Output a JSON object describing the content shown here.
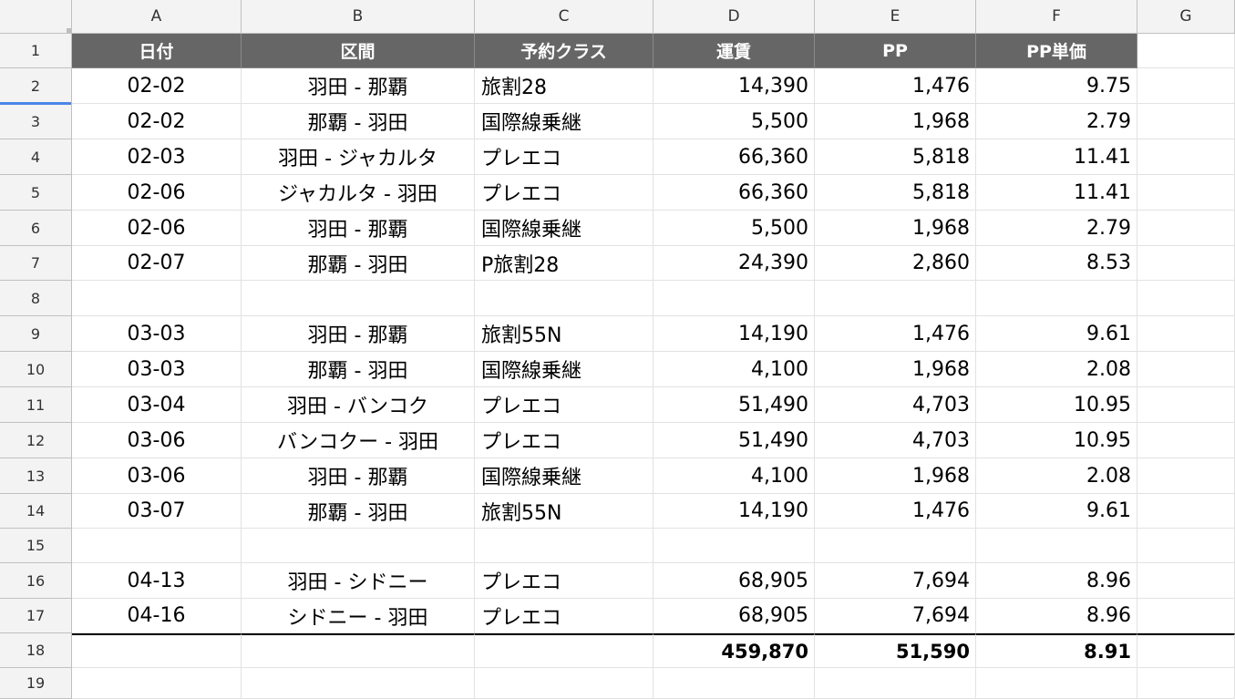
{
  "columns": [
    "A",
    "B",
    "C",
    "D",
    "E",
    "F",
    "G"
  ],
  "header": [
    "日付",
    "区間",
    "予約クラス",
    "運賃",
    "PP",
    "PP単価"
  ],
  "rows": [
    {
      "num": "1"
    },
    {
      "num": "2",
      "cells": [
        "02-02",
        "羽田 - 那覇",
        "旅割28",
        "14,390",
        "1,476",
        "9.75"
      ]
    },
    {
      "num": "3",
      "cells": [
        "02-02",
        "那覇 - 羽田",
        "国際線乗継",
        "5,500",
        "1,968",
        "2.79"
      ]
    },
    {
      "num": "4",
      "cells": [
        "02-03",
        "羽田 - ジャカルタ",
        "プレエコ",
        "66,360",
        "5,818",
        "11.41"
      ]
    },
    {
      "num": "5",
      "cells": [
        "02-06",
        "ジャカルタ - 羽田",
        "プレエコ",
        "66,360",
        "5,818",
        "11.41"
      ]
    },
    {
      "num": "6",
      "cells": [
        "02-06",
        "羽田 - 那覇",
        "国際線乗継",
        "5,500",
        "1,968",
        "2.79"
      ]
    },
    {
      "num": "7",
      "cells": [
        "02-07",
        "那覇 - 羽田",
        "P旅割28",
        "24,390",
        "2,860",
        "8.53"
      ]
    },
    {
      "num": "8",
      "cells": [
        "",
        "",
        "",
        "",
        "",
        ""
      ]
    },
    {
      "num": "9",
      "cells": [
        "03-03",
        "羽田 - 那覇",
        "旅割55N",
        "14,190",
        "1,476",
        "9.61"
      ]
    },
    {
      "num": "10",
      "cells": [
        "03-03",
        "那覇 - 羽田",
        "国際線乗継",
        "4,100",
        "1,968",
        "2.08"
      ]
    },
    {
      "num": "11",
      "cells": [
        "03-04",
        "羽田 - バンコク",
        "プレエコ",
        "51,490",
        "4,703",
        "10.95"
      ]
    },
    {
      "num": "12",
      "cells": [
        "03-06",
        "バンコクー - 羽田",
        "プレエコ",
        "51,490",
        "4,703",
        "10.95"
      ]
    },
    {
      "num": "13",
      "cells": [
        "03-06",
        "羽田 - 那覇",
        "国際線乗継",
        "4,100",
        "1,968",
        "2.08"
      ]
    },
    {
      "num": "14",
      "cells": [
        "03-07",
        "那覇 - 羽田",
        "旅割55N",
        "14,190",
        "1,476",
        "9.61"
      ]
    },
    {
      "num": "15",
      "cells": [
        "",
        "",
        "",
        "",
        "",
        ""
      ]
    },
    {
      "num": "16",
      "cells": [
        "04-13",
        "羽田 - シドニー",
        "プレエコ",
        "68,905",
        "7,694",
        "8.96"
      ]
    },
    {
      "num": "17",
      "cells": [
        "04-16",
        "シドニー - 羽田",
        "プレエコ",
        "68,905",
        "7,694",
        "8.96"
      ]
    },
    {
      "num": "18",
      "cells": [
        "",
        "",
        "",
        "459,870",
        "51,590",
        "8.91"
      ]
    },
    {
      "num": "19",
      "cells": [
        "",
        "",
        "",
        "",
        "",
        ""
      ]
    }
  ],
  "colors": {
    "header_bg": "#666666",
    "header_text": "#ffffff",
    "chrome_bg": "#f3f3f3",
    "gridline": "#e2e2e2",
    "selection": "#4a86e8"
  }
}
